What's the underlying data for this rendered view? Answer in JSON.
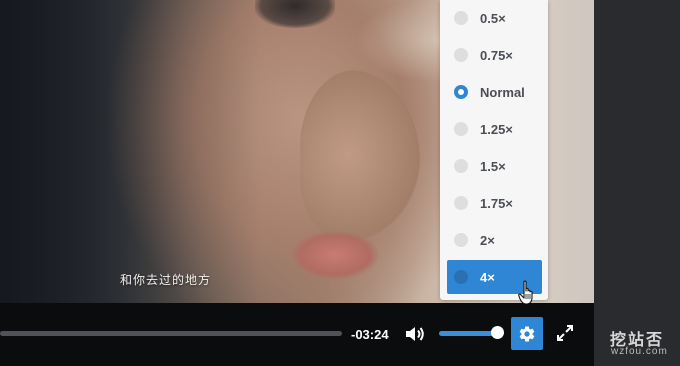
{
  "video": {
    "subtitle": "和你去过的地方"
  },
  "controls": {
    "progress_fraction": 0.99,
    "time_remaining": "-03:24",
    "volume_fraction": 0.95,
    "icons": [
      "volume-icon",
      "settings-gear-icon",
      "fullscreen-icon"
    ]
  },
  "speed_menu": {
    "items": [
      {
        "label": "0.5×"
      },
      {
        "label": "0.75×"
      },
      {
        "label": "Normal",
        "selected": true
      },
      {
        "label": "1.25×"
      },
      {
        "label": "1.5×"
      },
      {
        "label": "1.75×"
      },
      {
        "label": "2×"
      },
      {
        "label": "4×",
        "hovered": true
      }
    ]
  },
  "watermark": {
    "name": "挖站否",
    "url": "wzfou.com"
  },
  "colors": {
    "accent": "#2f86d4",
    "menu_bg": "#f6f6f6",
    "control_bar": "#0b0c0d"
  }
}
